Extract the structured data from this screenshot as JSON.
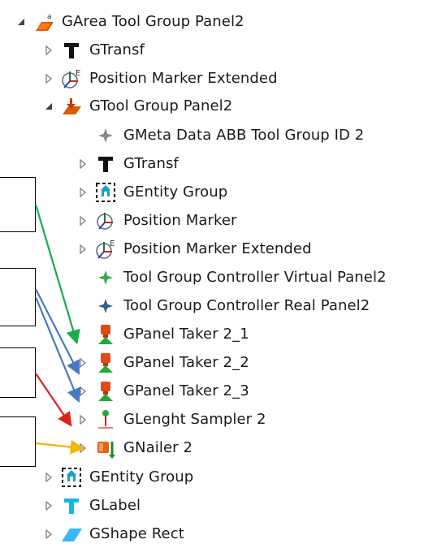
{
  "tree": {
    "items": [
      {
        "label": "GArea Tool Group Panel2",
        "icon": "area-tool-group-icon",
        "expander": "expanded"
      },
      {
        "label": "GTransf",
        "icon": "transform-icon",
        "expander": "collapsed"
      },
      {
        "label": "Position Marker Extended",
        "icon": "position-marker-extended-icon",
        "expander": "collapsed"
      },
      {
        "label": "GTool Group Panel2",
        "icon": "tool-group-icon",
        "expander": "expanded"
      },
      {
        "label": "GMeta Data ABB Tool Group ID 2",
        "icon": "meta-data-icon",
        "expander": "none"
      },
      {
        "label": "GTransf",
        "icon": "transform-icon",
        "expander": "collapsed"
      },
      {
        "label": "GEntity Group",
        "icon": "entity-group-icon",
        "expander": "collapsed"
      },
      {
        "label": "Position Marker",
        "icon": "position-marker-icon",
        "expander": "collapsed"
      },
      {
        "label": "Position Marker Extended",
        "icon": "position-marker-extended-icon",
        "expander": "collapsed"
      },
      {
        "label": "Tool Group Controller Virtual Panel2",
        "icon": "virtual-controller-icon",
        "expander": "none"
      },
      {
        "label": "Tool Group Controller Real Panel2",
        "icon": "real-controller-icon",
        "expander": "none"
      },
      {
        "label": "GPanel Taker 2_1",
        "icon": "panel-taker-icon",
        "expander": "none"
      },
      {
        "label": "GPanel Taker 2_2",
        "icon": "panel-taker-icon",
        "expander": "collapsed"
      },
      {
        "label": "GPanel Taker 2_3",
        "icon": "panel-taker-icon",
        "expander": "collapsed"
      },
      {
        "label": "GLenght Sampler 2",
        "icon": "length-sampler-icon",
        "expander": "collapsed"
      },
      {
        "label": "GNailer 2",
        "icon": "nailer-icon",
        "expander": "collapsed"
      },
      {
        "label": "GEntity Group",
        "icon": "entity-group-icon",
        "expander": "collapsed"
      },
      {
        "label": "GLabel",
        "icon": "label-icon",
        "expander": "collapsed"
      },
      {
        "label": "GShape Rect",
        "icon": "shape-rect-icon",
        "expander": "collapsed"
      }
    ]
  },
  "annotations": {
    "colors": {
      "green": "#1aaa4a",
      "blue": "#4a78c0",
      "red": "#e0201c",
      "orange": "#f5b400"
    }
  }
}
